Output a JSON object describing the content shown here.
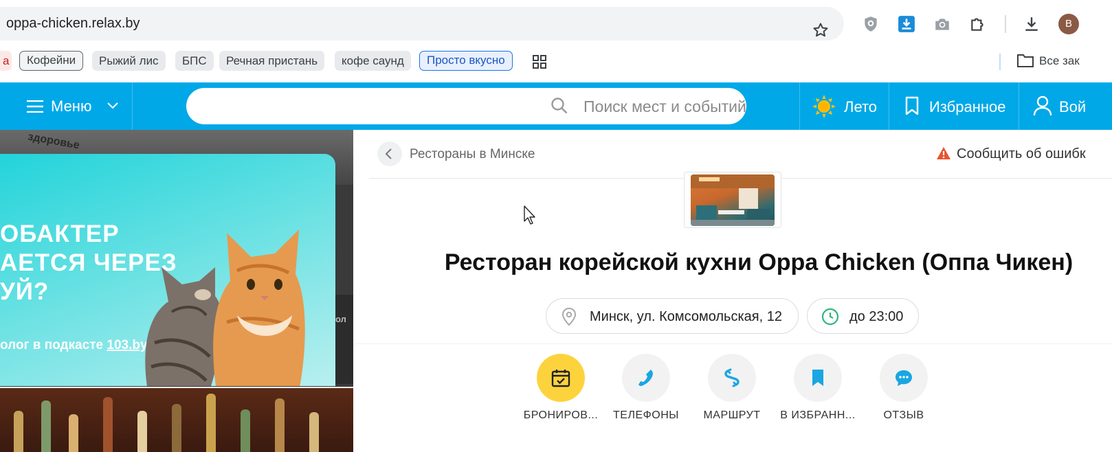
{
  "browser": {
    "url": "oppa-chicken.relax.by",
    "profile_initial": "B",
    "bookmarks": [
      {
        "label": "а"
      },
      {
        "label": "Кофейни"
      },
      {
        "label": "Рыжий лис"
      },
      {
        "label": "БПС"
      },
      {
        "label": "Речная пристань"
      },
      {
        "label": "кофе саунд"
      },
      {
        "label": "Просто вкусно"
      }
    ],
    "all_bookmarks_label": "Все зак"
  },
  "site_header": {
    "menu_label": "Меню",
    "search_placeholder": "Поиск мест и событий",
    "season_label": "Лето",
    "favorites_label": "Избранное",
    "login_label": "Вой"
  },
  "ad": {
    "background_word": "здоровье",
    "headline_lines": [
      "ОБАКТЕР",
      "АЕТСЯ ЧЕРЕЗ",
      "УЙ?"
    ],
    "subline_prefix": "олог в подкасте ",
    "subline_link": "103.by",
    "side_text": "ол"
  },
  "place": {
    "breadcrumb": "Рестораны в Минске",
    "report_error": "Сообщить об ошибк",
    "title": "Ресторан корейской кухни Oppa Chicken (Оппа Чикен)",
    "address": "Минск, ул. Комсомольская, 12",
    "hours": "до 23:00",
    "actions": [
      {
        "label": "БРОНИРОВ...",
        "icon": "calendar-check-icon"
      },
      {
        "label": "ТЕЛЕФОНЫ",
        "icon": "phone-icon"
      },
      {
        "label": "МАРШРУТ",
        "icon": "route-icon"
      },
      {
        "label": "В ИЗБРАНН...",
        "icon": "bookmark-icon"
      },
      {
        "label": "ОТЗЫВ",
        "icon": "chat-icon"
      }
    ]
  },
  "colors": {
    "header_blue": "#00a8e8",
    "booking_yellow": "#fdd33d",
    "warning_red": "#e8542f",
    "green_clock": "#2eb67d"
  }
}
